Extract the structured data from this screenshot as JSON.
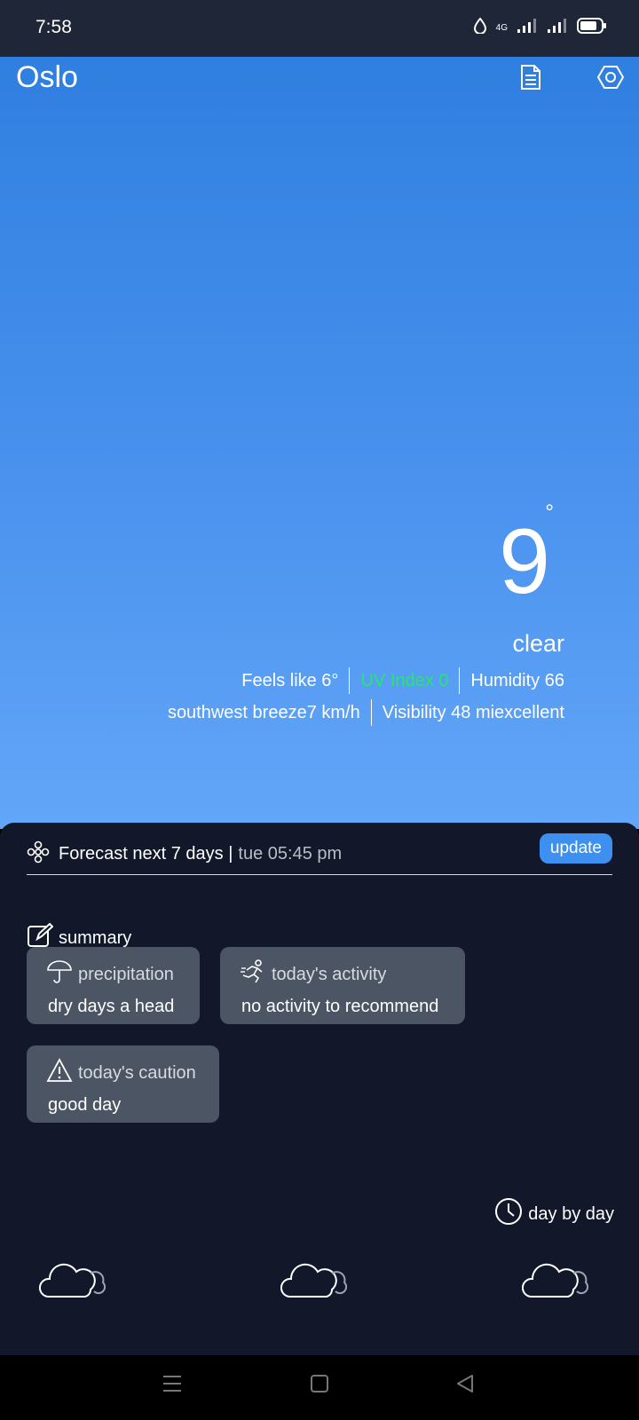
{
  "status_bar": {
    "time": "7:58",
    "network": "4G"
  },
  "header": {
    "city": "Oslo"
  },
  "current": {
    "temperature": "9",
    "degree_symbol": "°",
    "condition": "clear",
    "feels_like": "Feels like 6°",
    "uv_index": "UV Index 0",
    "humidity": "Humidity 66",
    "wind": "southwest breeze7 km/h",
    "visibility": "Visibility 48 miexcellent",
    "uv_color": "#23e86b"
  },
  "forecast": {
    "title": "Forecast next 7 days |",
    "updated_time": "tue 05:45 pm",
    "update_label": "update"
  },
  "summary": {
    "label": "summary",
    "cards": [
      {
        "title": "precipitation",
        "value": "dry days a head",
        "icon": "umbrella-icon"
      },
      {
        "title": "today's activity",
        "value": "no activity to recommend",
        "icon": "running-icon"
      },
      {
        "title": "today's caution",
        "value": "good day",
        "icon": "warning-icon"
      }
    ]
  },
  "day_by_day": {
    "label": "day by day"
  },
  "colors": {
    "accent": "#3d8ff0",
    "panel_bg": "#121829",
    "card_bg": "#4b5563"
  }
}
